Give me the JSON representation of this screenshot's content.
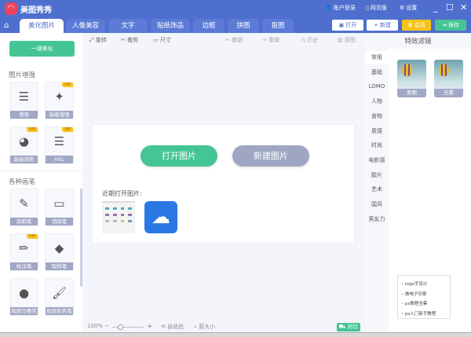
{
  "app": {
    "title": "美图秀秀",
    "logo_glyph": "◠"
  },
  "titlebar": {
    "login": "账户登录",
    "web": "网页版",
    "settings": "设置",
    "minimize": "_",
    "maximize": "☐",
    "close": "✕"
  },
  "tabs": [
    "美化图片",
    "人像美容",
    "文字",
    "贴纸饰品",
    "边框",
    "拼图",
    "抠图"
  ],
  "top_buttons": {
    "open": "打开",
    "new": "新建",
    "vip": "会员",
    "save": "保存"
  },
  "toolbar": {
    "rotate": "旋转",
    "crop": "裁剪",
    "size": "尺寸",
    "undo": "撤销",
    "redo": "重做",
    "history": "历史",
    "original": "原图"
  },
  "left": {
    "one_key": "一键美化",
    "section1": "图片增强",
    "section2": "各种画笔",
    "enhance_tiles": [
      {
        "label": "增强",
        "icon": "☰",
        "vip": ""
      },
      {
        "label": "高级增强",
        "icon": "✦",
        "vip": "VIP"
      },
      {
        "label": "高级调色",
        "icon": "◕",
        "vip": "VIP"
      },
      {
        "label": "HSL",
        "icon": "☰",
        "vip": "VIP"
      }
    ],
    "brush_tiles": [
      {
        "label": "涂鸦笔",
        "icon": "✎",
        "vip": ""
      },
      {
        "label": "消除笔",
        "icon": "▭",
        "vip": ""
      },
      {
        "label": "标注笔",
        "icon": "✏",
        "vip": "VIP"
      },
      {
        "label": "取样笔",
        "icon": "◆",
        "vip": ""
      },
      {
        "label": "局部马赛克",
        "icon": "●",
        "vip": ""
      },
      {
        "label": "局部彩色笔",
        "icon": "🖌",
        "vip": ""
      }
    ]
  },
  "canvas": {
    "open_image": "打开图片",
    "new_image": "新建图片",
    "recent_label": "近期打开图片:"
  },
  "bottom": {
    "zoom": "100%",
    "minus": "−",
    "plus": "+",
    "fit": "自适应",
    "actual": "原大小",
    "compare": "对比"
  },
  "right": {
    "title": "特效滤镜",
    "categories": [
      "常用",
      "基础",
      "LOMO",
      "人物",
      "食物",
      "质感",
      "时尚",
      "电影感",
      "胶片",
      "艺术",
      "国风",
      "男友力"
    ],
    "filters": [
      "原图",
      "去雾"
    ]
  },
  "ad": {
    "items": [
      "logo字设计",
      "做电子印章",
      "ps教程全集",
      "ps入门新手教程"
    ]
  },
  "colors": {
    "brand": "#4f6fcf",
    "green": "#45c593",
    "gray_btn": "#9ea6c4",
    "vip": "#f9c41a"
  }
}
